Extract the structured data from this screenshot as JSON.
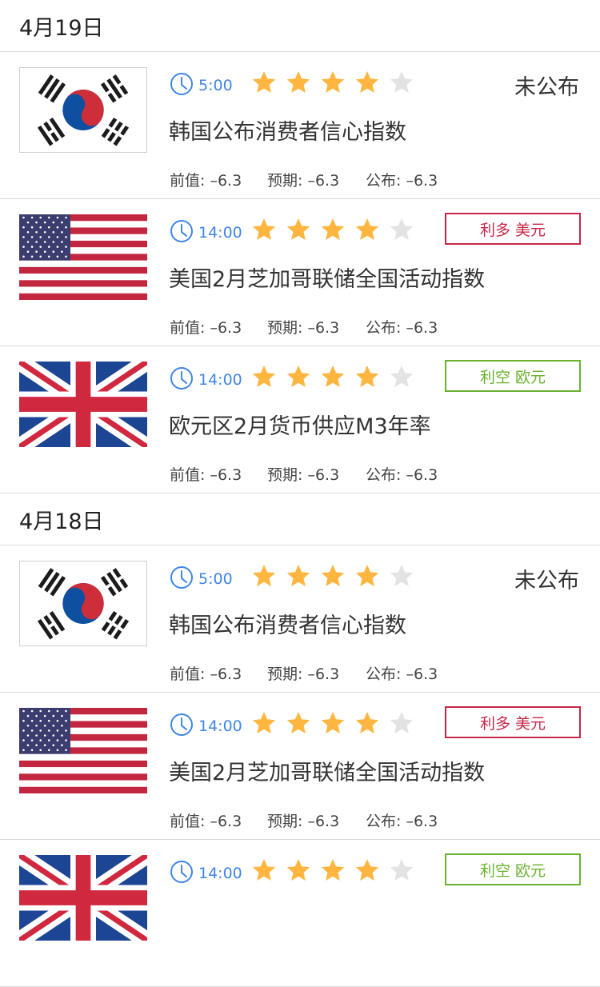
{
  "metric_labels": {
    "previous": "前值:",
    "forecast": "预期:",
    "actual": "公布:"
  },
  "colors": {
    "time_blue": "#3f86e6",
    "star_on": "#ffb640",
    "star_off": "#e3e3e3",
    "bull_red": "#c8274a",
    "bear_green": "#6ab22e"
  },
  "groups": [
    {
      "date": "4月19日",
      "events": [
        {
          "flag": "korea-flag",
          "time": "5:00",
          "stars": 4,
          "max_stars": 5,
          "status": "未公布",
          "badge": null,
          "title": "韩国公布消费者信心指数",
          "previous": "–6.3",
          "forecast": "–6.3",
          "actual": "–6.3"
        },
        {
          "flag": "usa-flag",
          "time": "14:00",
          "stars": 4,
          "max_stars": 5,
          "status": null,
          "badge": {
            "type": "bull",
            "label": "利多 美元"
          },
          "title": "美国2月芝加哥联储全国活动指数",
          "previous": "–6.3",
          "forecast": "–6.3",
          "actual": "–6.3"
        },
        {
          "flag": "uk-flag",
          "time": "14:00",
          "stars": 4,
          "max_stars": 5,
          "status": null,
          "badge": {
            "type": "bear",
            "label": "利空 欧元"
          },
          "title": "欧元区2月货币供应M3年率",
          "previous": "–6.3",
          "forecast": "–6.3",
          "actual": "–6.3"
        }
      ]
    },
    {
      "date": "4月18日",
      "events": [
        {
          "flag": "korea-flag",
          "time": "5:00",
          "stars": 4,
          "max_stars": 5,
          "status": "未公布",
          "badge": null,
          "title": "韩国公布消费者信心指数",
          "previous": "–6.3",
          "forecast": "–6.3",
          "actual": "–6.3"
        },
        {
          "flag": "usa-flag",
          "time": "14:00",
          "stars": 4,
          "max_stars": 5,
          "status": null,
          "badge": {
            "type": "bull",
            "label": "利多 美元"
          },
          "title": "美国2月芝加哥联储全国活动指数",
          "previous": "–6.3",
          "forecast": "–6.3",
          "actual": "–6.3"
        },
        {
          "flag": "uk-flag",
          "time": "14:00",
          "stars": 4,
          "max_stars": 5,
          "status": null,
          "badge": {
            "type": "bear",
            "label": "利空 欧元"
          },
          "title": "",
          "previous": "",
          "forecast": "",
          "actual": ""
        }
      ]
    }
  ]
}
